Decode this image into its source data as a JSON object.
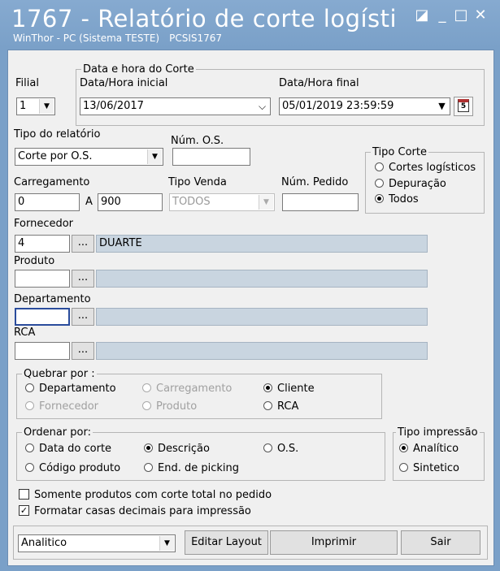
{
  "window": {
    "title": "1767 - Relatório de corte logísti",
    "subtitle": "WinThor - PC (Sistema TESTE)",
    "subtitle_code": "PCSIS1767",
    "minimize_label": "_",
    "maximize_label": "□",
    "close_label": "✕",
    "restore_label": "◪"
  },
  "filial": {
    "label": "Filial",
    "value": "1"
  },
  "data_corte": {
    "legend": "Data e hora do Corte",
    "inicial_label": "Data/Hora inicial",
    "inicial_value": "13/06/2017",
    "final_label": "Data/Hora final",
    "final_value": "05/01/2019 23:59:59",
    "calendar_number": "5"
  },
  "tipo_relatorio": {
    "label": "Tipo do relatório",
    "value": "Corte por O.S."
  },
  "num_os": {
    "label": "Núm. O.S.",
    "value": ""
  },
  "tipo_corte": {
    "legend": "Tipo Corte",
    "options": [
      "Cortes logísticos",
      "Depuração",
      "Todos"
    ],
    "selected": "Todos"
  },
  "carregamento": {
    "label": "Carregamento",
    "from": "0",
    "sep": "A",
    "to": "900"
  },
  "tipo_venda": {
    "label": "Tipo Venda",
    "value": "TODOS"
  },
  "num_pedido": {
    "label": "Núm. Pedido",
    "value": ""
  },
  "fornecedor": {
    "label": "Fornecedor",
    "code": "4",
    "name": "DUARTE"
  },
  "produto": {
    "label": "Produto",
    "code": "",
    "name": ""
  },
  "departamento": {
    "label": "Departamento",
    "code": "",
    "name": ""
  },
  "rca": {
    "label": "RCA",
    "code": "",
    "name": ""
  },
  "browse_label": "...",
  "quebrar": {
    "legend": "Quebrar por :",
    "options": [
      "Departamento",
      "Carregamento",
      "Cliente",
      "Fornecedor",
      "Produto",
      "RCA"
    ],
    "selected": "Cliente"
  },
  "ordenar": {
    "legend": "Ordenar por:",
    "options": [
      "Data do corte",
      "Descrição",
      "O.S.",
      "Código produto",
      "End. de picking"
    ],
    "selected": "Descrição"
  },
  "tipo_impressao": {
    "legend": "Tipo impressão",
    "options": [
      "Analítico",
      "Sintetico"
    ],
    "selected": "Analítico"
  },
  "checks": {
    "corte_total": {
      "label": "Somente produtos com corte total no pedido",
      "checked": false
    },
    "casas_decimais": {
      "label": "Formatar casas decimais para impressão",
      "checked": true
    }
  },
  "footer": {
    "layout_value": "Analitico",
    "editar_label": "Editar Layout",
    "imprimir_label": "Imprimir",
    "sair_label": "Sair"
  }
}
